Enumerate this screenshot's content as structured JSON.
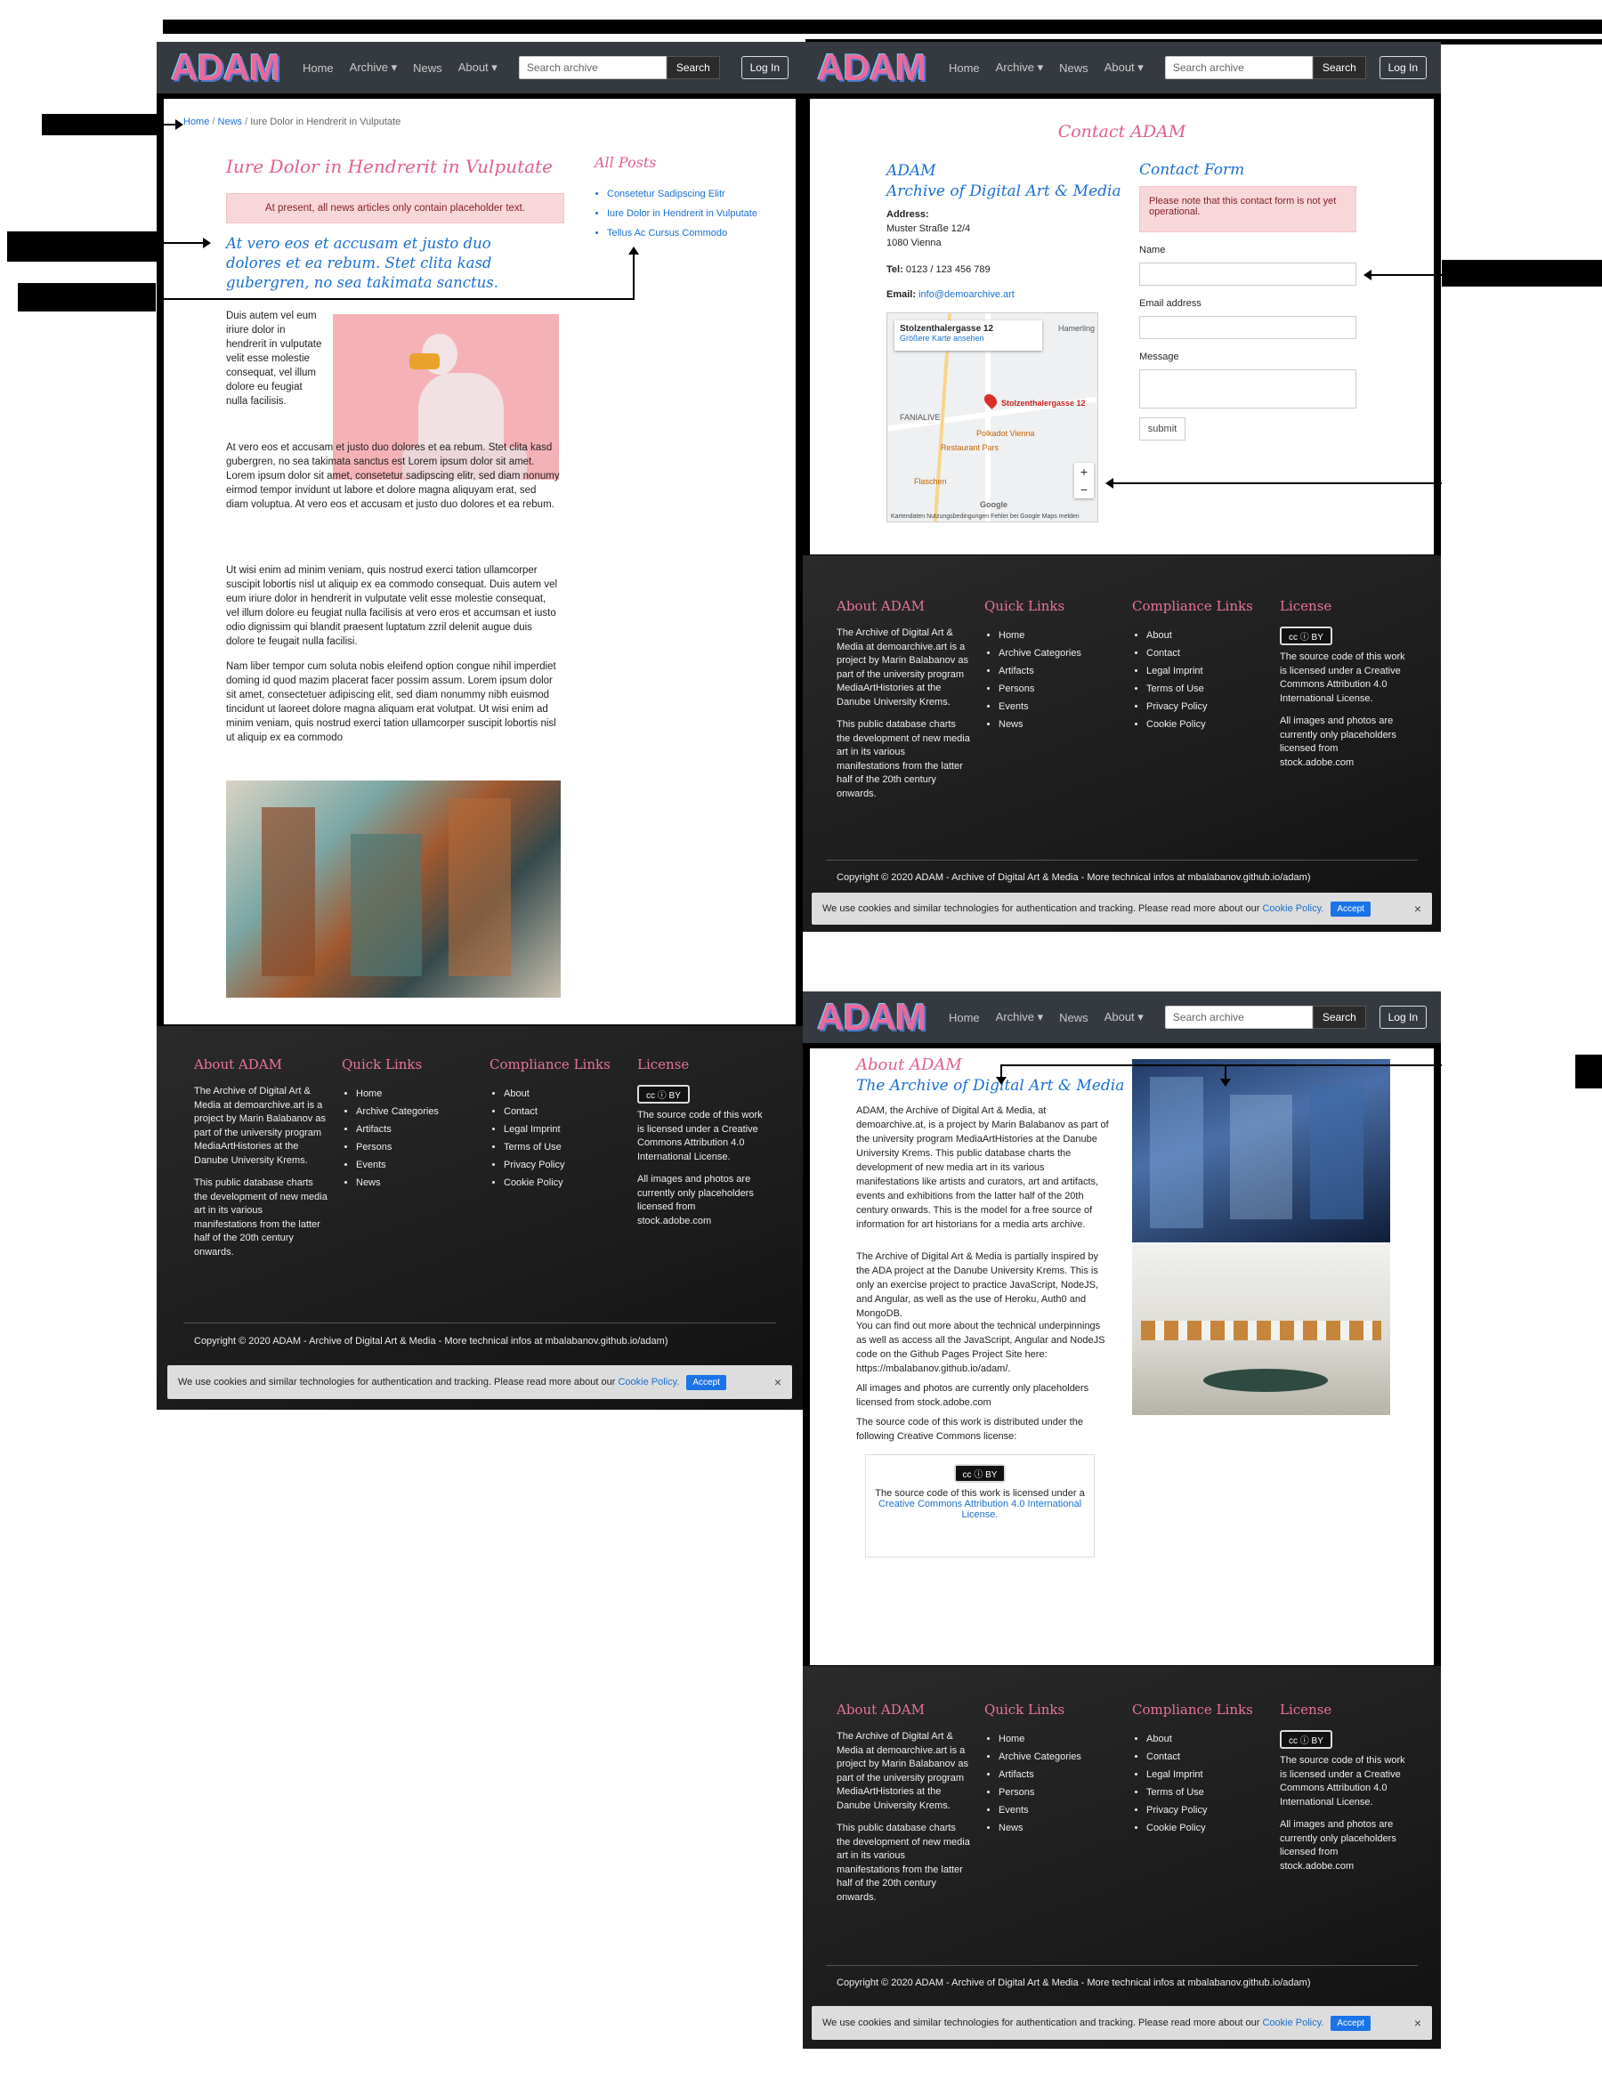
{
  "nav": {
    "logo": "ADAM",
    "home": "Home",
    "archive": "Archive ▾",
    "news": "News",
    "about": "About ▾",
    "search_placeholder": "Search archive",
    "search_button": "Search",
    "login": "Log In"
  },
  "article": {
    "breadcrumb_home": "Home",
    "breadcrumb_news": "News",
    "breadcrumb_current": "Iure Dolor in Hendrerit in Vulputate",
    "title": "Iure Dolor in Hendrerit in Vulputate",
    "notice": "At present, all news articles only contain placeholder text.",
    "lead": "At vero eos et accusam et justo duo dolores et ea rebum. Stet clita kasd gubergren, no sea takimata sanctus.",
    "p1": "Duis autem vel eum iriure dolor in hendrerit in vulputate velit esse molestie consequat, vel illum dolore eu feugiat nulla facilisis.",
    "p2": "At vero eos et accusam et justo duo dolores et ea rebum. Stet clita kasd gubergren, no sea takimata sanctus est Lorem ipsum dolor sit amet. Lorem ipsum dolor sit amet, consetetur sadipscing elitr, sed diam nonumy eirmod tempor invidunt ut labore et dolore magna aliquyam erat, sed diam voluptua. At vero eos et accusam et justo duo dolores et ea rebum.",
    "p3": "Ut wisi enim ad minim veniam, quis nostrud exerci tation ullamcorper suscipit lobortis nisl ut aliquip ex ea commodo consequat. Duis autem vel eum iriure dolor in hendrerit in vulputate velit esse molestie consequat, vel illum dolore eu feugiat nulla facilisis at vero eros et accumsan et iusto odio dignissim qui blandit praesent luptatum zzril delenit augue duis dolore te feugait nulla facilisi.",
    "p4": "Nam liber tempor cum soluta nobis eleifend option congue nihil imperdiet doming id quod mazim placerat facer possim assum. Lorem ipsum dolor sit amet, consectetuer adipiscing elit, sed diam nonummy nibh euismod tincidunt ut laoreet dolore magna aliquam erat volutpat. Ut wisi enim ad minim veniam, quis nostrud exerci tation ullamcorper suscipit lobortis nisl ut aliquip ex ea commodo",
    "all_posts_title": "All Posts",
    "posts": [
      "Consetetur Sadipscing Elitr",
      "Iure Dolor in Hendrerit in Vulputate",
      "Tellus Ac Cursus Commodo"
    ]
  },
  "contact": {
    "title": "Contact ADAM",
    "org1": "ADAM",
    "org2": "Archive of Digital Art & Media",
    "address_label": "Address:",
    "street": "Muster Straße 12/4",
    "city": "1080 Vienna",
    "tel_label": "Tel:",
    "tel": "0123 / 123 456 789",
    "email_label": "Email:",
    "email": "info@demoarchive.art",
    "map_place": "Stolzenthalergasse 12",
    "map_link": "Größere Karte ansehen",
    "map_pin": "Stolzenthalergasse 12",
    "map_label_1": "FANIALIVE",
    "map_label_2": "Polkadot Vienna",
    "map_label_3": "Restaurant Pars",
    "map_label_4": "Flaschen",
    "map_label_5": "Hamerling",
    "map_google": "Google",
    "map_footer": "Kartendaten   Nutzungsbedingungen   Fehler bei Google Maps melden",
    "form_title": "Contact Form",
    "form_notice": "Please note that this contact form is not yet operational.",
    "name_label": "Name",
    "email_field_label": "Email address",
    "message_label": "Message",
    "submit": "submit"
  },
  "about": {
    "title": "About ADAM",
    "subtitle": "The Archive of Digital Art & Media",
    "p1": "ADAM, the Archive of Digital Art & Media, at demoarchive.at, is a project by Marin Balabanov as part of the university program MediaArtHistories at the Danube University Krems. This public database charts the development of new media art in its various manifestations like artists and curators, art and artifacts, events and exhibitions from the latter half of the 20th century onwards. This is the model for a free source of information for art historians for a media arts archive.",
    "p2": "The Archive of Digital Art & Media is partially inspired by the ADA project at the Danube University Krems. This is only an exercise project to practice JavaScript, NodeJS, and Angular, as well as the use of Heroku, Auth0 and MongoDB.",
    "p3": "You can find out more about the technical underpinnings as well as access all the JavaScript, Angular and NodeJS code on the Github Pages Project Site here: https://mbalabanov.github.io/adam/.",
    "p4": "All images and photos are currently only placeholders licensed from stock.adobe.com",
    "p5": "The source code of this work is distributed under the following Creative Commons license:",
    "cc_badge": "cc ⓘ BY",
    "license_box": "The source code of this work is licensed under a",
    "license_link": "Creative Commons Attribution 4.0 International License."
  },
  "footer": {
    "about_title": "About ADAM",
    "about_text": "The Archive of Digital Art & Media at demoarchive.art is a project by Marin Balabanov as part of the university program MediaArtHistories at the Danube University Krems.",
    "about_text2": "This public database charts the development of new media art in its various manifestations from the latter half of the 20th century onwards.",
    "quick_title": "Quick Links",
    "quick": [
      "Home",
      "Archive Categories",
      "Artifacts",
      "Persons",
      "Events",
      "News"
    ],
    "compliance_title": "Compliance Links",
    "compliance": [
      "About",
      "Contact",
      "Legal Imprint",
      "Terms of Use",
      "Privacy Policy",
      "Cookie Policy"
    ],
    "license_title": "License",
    "cc_badge": "cc ⓘ BY",
    "license_text": "The source code of this work is licensed under a Creative Commons Attribution 4.0 International License.",
    "images_text": "All images and photos are currently only placeholders licensed from stock.adobe.com",
    "copyright": "Copyright © 2020 ADAM - Archive of Digital Art & Media - More technical infos at mbalabanov.github.io/adam)"
  },
  "cookie": {
    "text": "We use cookies and similar technologies for authentication and tracking. Please read more about our",
    "link": "Cookie Policy.",
    "accept": "Accept",
    "close": "×"
  }
}
